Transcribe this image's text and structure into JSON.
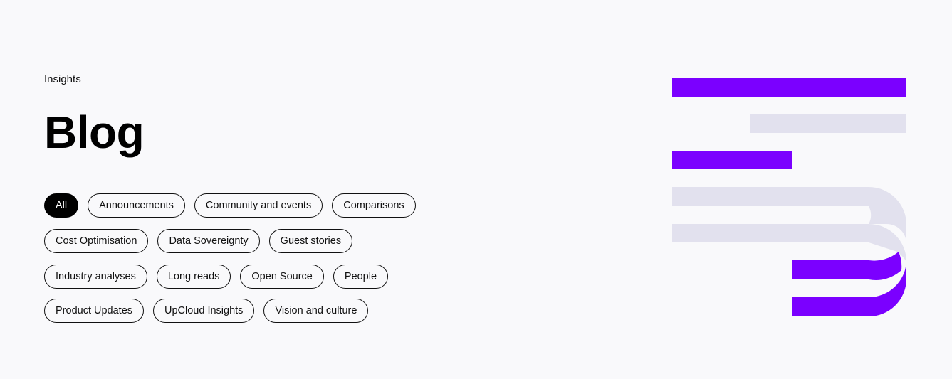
{
  "header": {
    "eyebrow": "Insights",
    "title": "Blog"
  },
  "filters": {
    "active": "All",
    "rows": [
      [
        "All",
        "Announcements",
        "Community and events",
        "Comparisons"
      ],
      [
        "Cost Optimisation",
        "Data Sovereignty",
        "Guest stories"
      ],
      [
        "Industry analyses",
        "Long reads",
        "Open Source",
        "People"
      ],
      [
        "Product Updates",
        "UpCloud Insights",
        "Vision and culture"
      ]
    ]
  },
  "colors": {
    "background": "#f9f9fb",
    "brand_purple": "#7b00ff",
    "light_lavender": "#e2e1ee",
    "chip_active_bg": "#000000",
    "text": "#000000"
  },
  "icons": {
    "decorative_logo": "upcloud-stripes-logo-icon"
  }
}
